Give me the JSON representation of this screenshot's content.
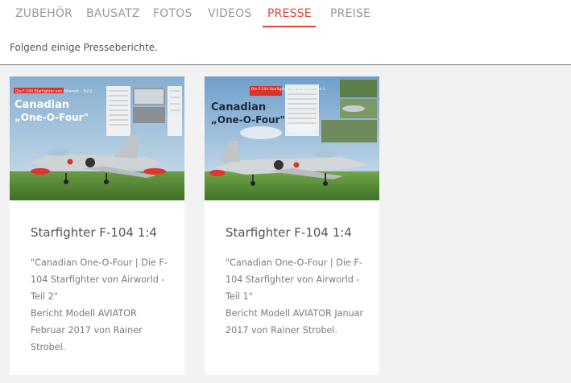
{
  "tabs": [
    {
      "label": "ZUBEHÖR",
      "active": false
    },
    {
      "label": "BAUSATZ",
      "active": false
    },
    {
      "label": "FOTOS",
      "active": false
    },
    {
      "label": "VIDEOS",
      "active": false
    },
    {
      "label": "PRESSE",
      "active": true
    },
    {
      "label": "PREISE",
      "active": false
    }
  ],
  "intro": "Folgend einige Presseberichte.",
  "colors": {
    "accent": "#e0463b",
    "text": "#7b7b7b",
    "background": "#f2f2f2"
  },
  "cards": [
    {
      "title": "Starfighter F-104 1:4",
      "description": "\"Canadian One-O-Four | Die F-104 Starfighter von Airworld - Teil 2\"",
      "report": "Bericht Modell AVIATOR Februar 2017 von Rainer Strobel.",
      "thumb": {
        "kicker": "Die F-104 Starfighter von Airworld – Teil 2",
        "headline_1": "Canadian",
        "headline_2": "„One-O-Four\""
      }
    },
    {
      "title": "Starfighter F-104 1:4",
      "description": "\"Canadian One-O-Four | Die F-104 Starfighter von Airworld - Teil 1\"",
      "report": "Bericht Modell AVIATOR Januar 2017 von Rainer Strobel.",
      "thumb": {
        "kicker": "Die F-104 Starfighter von Airworld – Teil 1",
        "headline_1": "Canadian",
        "headline_2": "„One-O-Four\""
      }
    }
  ]
}
